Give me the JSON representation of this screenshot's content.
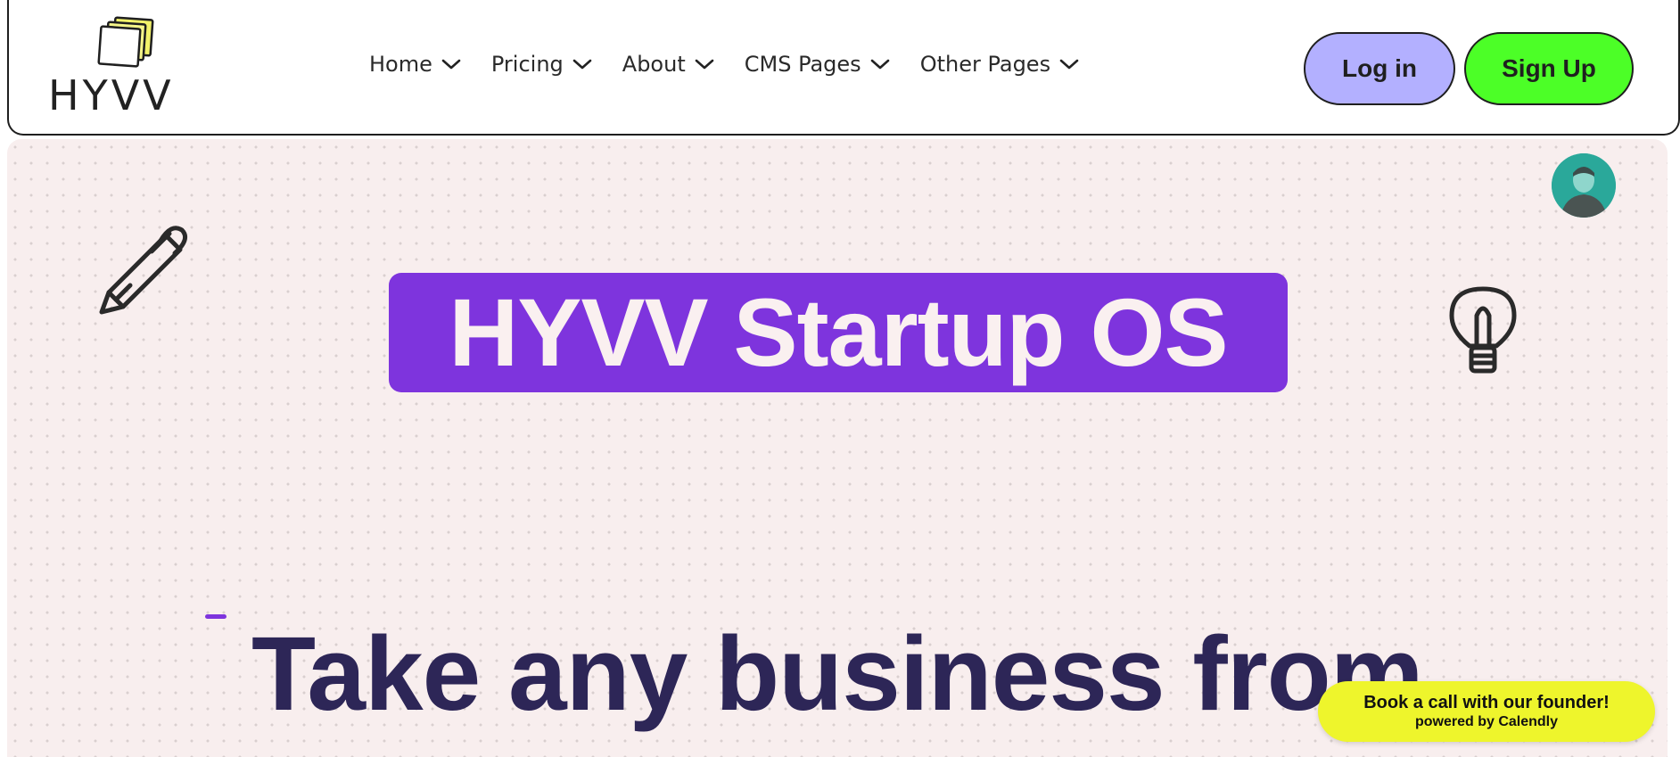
{
  "brand": {
    "logo_text": "HYVV",
    "logo_icon": "stacked-cards-logo"
  },
  "nav": {
    "items": [
      {
        "label": "Home",
        "icon": "chevron-down-icon"
      },
      {
        "label": "Pricing",
        "icon": "chevron-down-icon"
      },
      {
        "label": "About",
        "icon": "chevron-down-icon"
      },
      {
        "label": "CMS Pages",
        "icon": "chevron-down-icon"
      },
      {
        "label": "Other Pages",
        "icon": "chevron-down-icon"
      }
    ],
    "login_label": "Log in",
    "signup_label": "Sign Up"
  },
  "hero": {
    "badge_text": "HYVV Startup OS",
    "headline": "Take any business from",
    "icons": [
      "pen-icon",
      "lightbulb-icon",
      "avatar"
    ]
  },
  "calendly": {
    "title": "Book a call with our founder!",
    "subtitle": "powered by Calendly"
  },
  "colors": {
    "login_bg": "#b3b0ff",
    "signup_bg": "#4cff27",
    "badge_bg": "#7e34dd",
    "hero_bg": "#f8eeee",
    "headline": "#2d2657",
    "calendly_bg": "#eef52c"
  }
}
